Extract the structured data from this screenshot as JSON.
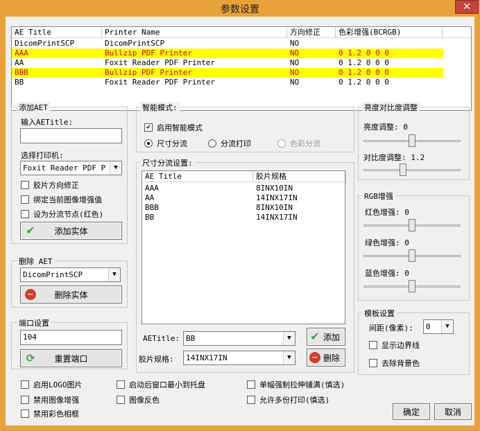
{
  "window": {
    "title": "参数设置",
    "close_label": "✕"
  },
  "ae_table": {
    "columns": [
      "AE Title",
      "Printer Name",
      "方向修正",
      "色彩增强(BCRGB)"
    ],
    "rows": [
      {
        "ae": "DicomPrintSCP",
        "printer": "DicomPrintSCP",
        "orient": "NO",
        "color": "",
        "highlight": false
      },
      {
        "ae": "AAA",
        "printer": "Bullzip PDF Printer",
        "orient": "NO",
        "color": "0 1.2 0 0 0",
        "highlight": true
      },
      {
        "ae": "AA",
        "printer": "Foxit Reader PDF Printer",
        "orient": "NO",
        "color": "0 1.2 0 0 0",
        "highlight": false
      },
      {
        "ae": "BBB",
        "printer": "Bullzip PDF Printer",
        "orient": "NO",
        "color": "0 1.2 0 0 0",
        "highlight": true
      },
      {
        "ae": "BB",
        "printer": "Foxit Reader PDF Printer",
        "orient": "NO",
        "color": "0 1.2 0 0 0",
        "highlight": false
      }
    ]
  },
  "add_aet": {
    "group_title": "添加AET",
    "input_label": "输入AETitle:",
    "input_value": "",
    "printer_label": "选择打印机:",
    "printer_value": "Foxit Reader PDF P",
    "chk_orient": "胶片方向修正",
    "chk_bind": "绑定当前图像增强值",
    "chk_split": "设为分流节点(红色)",
    "add_button": "添加实体"
  },
  "delete_aet": {
    "group_title": "删除 AET",
    "value": "DicomPrintSCP",
    "delete_button": "删除实体"
  },
  "port": {
    "group_title": "端口设置",
    "value": "104",
    "reset_button": "重置端口"
  },
  "smart": {
    "group_title": "智能模式:",
    "enable_label": "启用智能模式",
    "radio_size": "尺寸分流",
    "radio_split_print": "分流打印",
    "radio_color": "色彩分流"
  },
  "size_split": {
    "group_title": "尺寸分流设置:",
    "columns": [
      "AE Title",
      "胶片规格"
    ],
    "rows": [
      {
        "ae": "AAA",
        "size": "8INX10IN"
      },
      {
        "ae": "AA",
        "size": "14INX17IN"
      },
      {
        "ae": "BBB",
        "size": "8INX10IN"
      },
      {
        "ae": "BB",
        "size": "14INX17IN"
      }
    ],
    "ae_label": "AETitle:",
    "ae_value": "BB",
    "size_label": "胶片规格:",
    "size_value": "14INX17IN",
    "add_button": "添加",
    "delete_button": "删除"
  },
  "brightness": {
    "group_title": "亮度对比度调整",
    "brightness_label": "亮度调整: 0",
    "brightness_level": 0.5,
    "contrast_label": "对比度调整: 1.2",
    "contrast_level": 0.4
  },
  "rgb": {
    "group_title": "RGB增强",
    "red_label": "红色增强: 0",
    "red_level": 0.5,
    "green_label": "绿色增强: 0",
    "green_level": 0.5,
    "blue_label": "蓝色增强: 0",
    "blue_level": 0.5
  },
  "template": {
    "group_title": "模板设置",
    "spacing_label": "间距(像素):",
    "spacing_value": "0",
    "chk_border": "显示边界线",
    "chk_bg": "去除背景色"
  },
  "bottom": {
    "logo": "启用LOGO图片",
    "minimize": "启动后窗口最小到托盘",
    "stretch": "单幅强制拉伸铺满(慎选)",
    "disable_enhance": "禁用图像增强",
    "invert": "图像反色",
    "multi_print": "允许多份打印(慎选)",
    "disable_color_frame": "禁用彩色相框",
    "ok_button": "确定",
    "cancel_button": "取消"
  }
}
